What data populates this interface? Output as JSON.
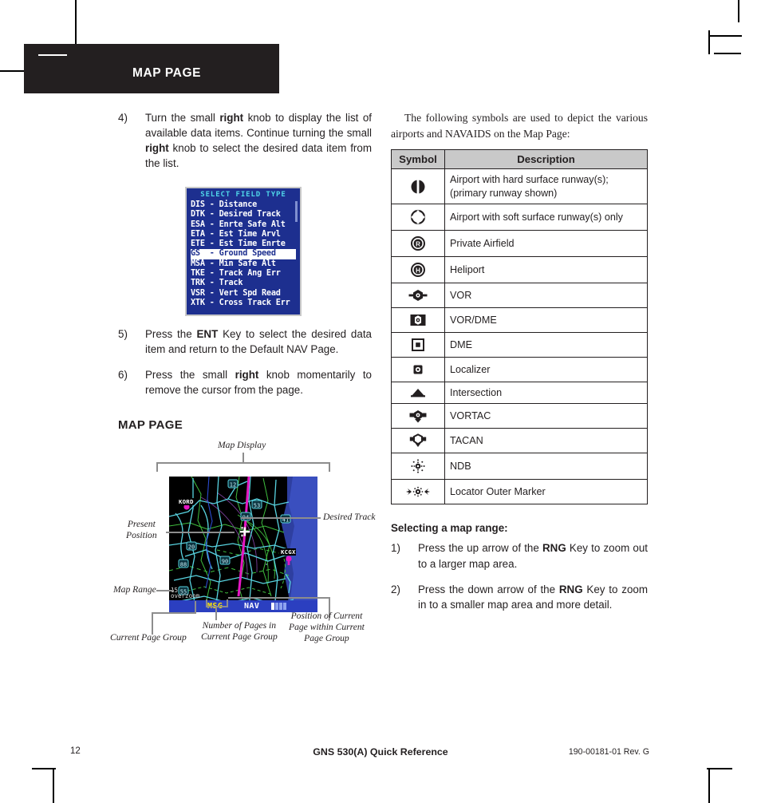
{
  "header": {
    "banner_title": "MAP PAGE"
  },
  "left_column": {
    "steps": [
      {
        "num": "4)",
        "parts": [
          {
            "t": "Turn the small ",
            "b": false
          },
          {
            "t": "right",
            "b": true
          },
          {
            "t": " knob to display the list of available data items.  Continue turning the small ",
            "b": false
          },
          {
            "t": "right",
            "b": true
          },
          {
            "t": " knob to select the desired data item from the list.",
            "b": false
          }
        ]
      },
      {
        "num": "5)",
        "parts": [
          {
            "t": "Press the ",
            "b": false
          },
          {
            "t": "ENT",
            "b": true
          },
          {
            "t": " Key to select the desired data item and return to the Default NAV Page.",
            "b": false
          }
        ]
      },
      {
        "num": "6)",
        "parts": [
          {
            "t": "Press the small ",
            "b": false
          },
          {
            "t": "right",
            "b": true
          },
          {
            "t": " knob momentarily to remove the cursor from the page.",
            "b": false
          }
        ]
      }
    ],
    "subhead": "MAP PAGE"
  },
  "select_field_screen": {
    "title": "SELECT FIELD TYPE",
    "rows": [
      {
        "abbr": "DIS",
        "name": "Distance",
        "selected": false
      },
      {
        "abbr": "DTK",
        "name": "Desired Track",
        "selected": false
      },
      {
        "abbr": "ESA",
        "name": "Enrte Safe Alt",
        "selected": false
      },
      {
        "abbr": "ETA",
        "name": "Est Time Arvl",
        "selected": false
      },
      {
        "abbr": "ETE",
        "name": "Est Time Enrte",
        "selected": false
      },
      {
        "abbr": "GS",
        "name": "Ground Speed",
        "selected": true
      },
      {
        "abbr": "MSA",
        "name": "Min Safe Alt",
        "selected": false
      },
      {
        "abbr": "TKE",
        "name": "Track Ang Err",
        "selected": false
      },
      {
        "abbr": "TRK",
        "name": "Track",
        "selected": false
      },
      {
        "abbr": "VSR",
        "name": "Vert Spd Read",
        "selected": false
      },
      {
        "abbr": "XTK",
        "name": "Cross Track Err",
        "selected": false
      }
    ],
    "separator": "-"
  },
  "right_column": {
    "intro_line1": "The following symbols are used to depict the various",
    "intro_line2": "airports and NAVAIDS on the Map Page:",
    "table": {
      "headers": [
        "Symbol",
        "Description"
      ],
      "rows": [
        {
          "icon": "airport-hard-surface-icon",
          "desc": "Airport with hard surface runway(s); (primary runway shown)"
        },
        {
          "icon": "airport-soft-surface-icon",
          "desc": "Airport with soft surface runway(s) only"
        },
        {
          "icon": "private-airfield-icon",
          "desc": "Private Airfield"
        },
        {
          "icon": "heliport-icon",
          "desc": "Heliport"
        },
        {
          "icon": "vor-icon",
          "desc": "VOR"
        },
        {
          "icon": "vor-dme-icon",
          "desc": "VOR/DME"
        },
        {
          "icon": "dme-icon",
          "desc": "DME"
        },
        {
          "icon": "localizer-icon",
          "desc": "Localizer"
        },
        {
          "icon": "intersection-icon",
          "desc": "Intersection"
        },
        {
          "icon": "vortac-icon",
          "desc": "VORTAC"
        },
        {
          "icon": "tacan-icon",
          "desc": "TACAN"
        },
        {
          "icon": "ndb-icon",
          "desc": "NDB"
        },
        {
          "icon": "locator-outer-marker-icon",
          "desc": "Locator Outer Marker"
        }
      ]
    },
    "map_range_head": "Selecting a map range:",
    "map_range_steps": [
      {
        "num": "1)",
        "parts": [
          {
            "t": "Press the up arrow of the ",
            "b": false
          },
          {
            "t": "RNG",
            "b": true
          },
          {
            "t": " Key to zoom out to a larger map area.",
            "b": false
          }
        ]
      },
      {
        "num": "2)",
        "parts": [
          {
            "t": "Press the down arrow of the ",
            "b": false
          },
          {
            "t": "RNG",
            "b": true
          },
          {
            "t": " Key to zoom in to a smaller map area and more detail.",
            "b": false
          }
        ]
      }
    ]
  },
  "map_figure": {
    "labels": {
      "map_display": "Map Display",
      "desired_track": "Desired Track",
      "present_position": "Present\nPosition",
      "map_range": "Map Range",
      "current_page_group": "Current Page Group",
      "number_of_pages": "Number of Pages in\nCurrent Page Group",
      "position_of_page": "Position of Current\nPage within Current\nPage Group"
    },
    "screen": {
      "range_text": "15\noverzoom",
      "msg_label": "MSG",
      "nav_label": "NAV",
      "page_bars": [
        true,
        false,
        false,
        false
      ],
      "airport_labels": [
        "KORD",
        "KCGX"
      ],
      "highway_shields": [
        "12",
        "53",
        "94",
        "41",
        "20",
        "90",
        "88",
        "55"
      ]
    },
    "colors": {
      "map_background": "#000000",
      "roads": "#58d3e0",
      "airspace": "#3fbf3f",
      "water": "#3a4fbf",
      "desired_track": "#e617c3",
      "status_bar": "#2b3fc0",
      "msg_color": "#ffe400"
    }
  },
  "footer": {
    "page_number": "12",
    "title": "GNS 530(A) Quick Reference",
    "doc_id": "190-00181-01  Rev. G"
  }
}
